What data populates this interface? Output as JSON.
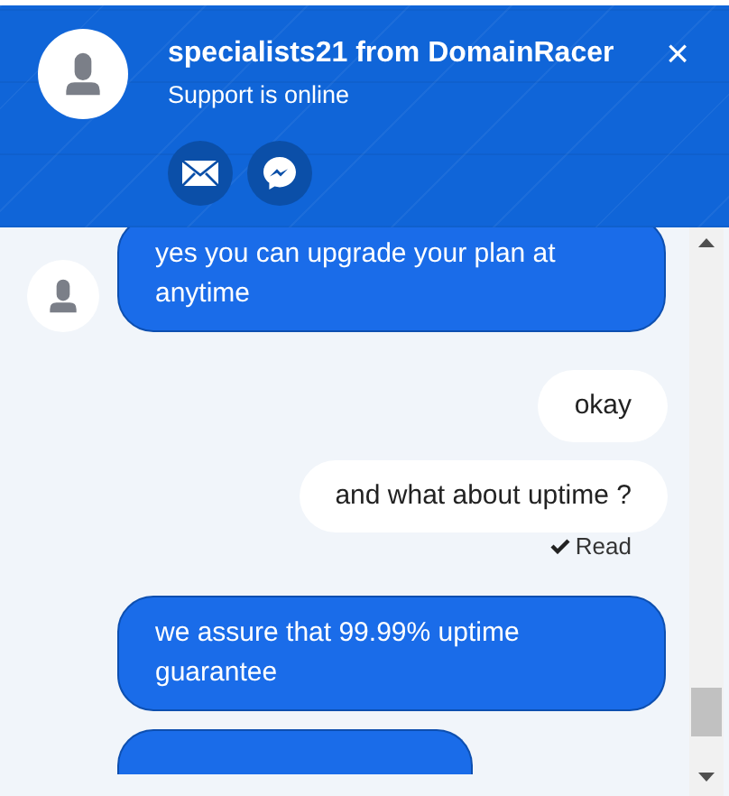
{
  "header": {
    "title": "specialists21 from DomainRacer",
    "status": "Support is online",
    "close": "×"
  },
  "messages": [
    {
      "kind": "agent",
      "text": "yes you can upgrade your plan at anytime",
      "avatar": true
    },
    {
      "kind": "user",
      "text": "okay"
    },
    {
      "kind": "user",
      "text": "and what about uptime ?"
    },
    {
      "kind": "receipt",
      "text": "Read"
    },
    {
      "kind": "agent",
      "text": "we assure that 99.99% uptime guarantee",
      "avatar": false
    },
    {
      "kind": "agent_partial",
      "avatar": false
    }
  ]
}
